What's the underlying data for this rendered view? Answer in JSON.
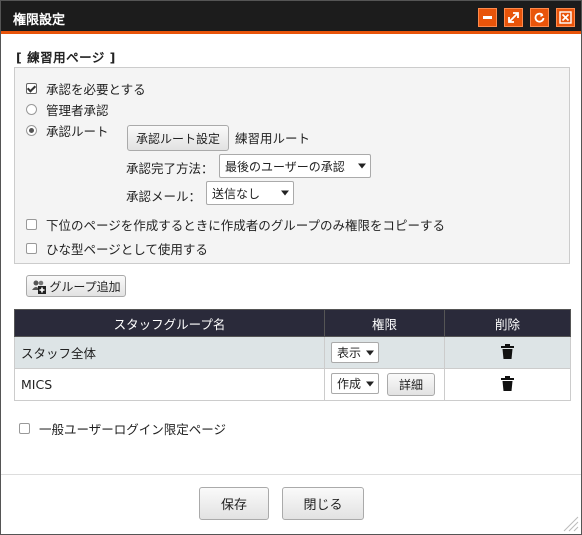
{
  "window": {
    "title": "権限設定"
  },
  "page": {
    "name": "[ 練習用ページ ]"
  },
  "approval": {
    "require_label": "承認を必要とする",
    "admin_label": "管理者承認",
    "route_label": "承認ルート",
    "route_button": "承認ルート設定",
    "route_name": "練習用ルート",
    "complete_method_label": "承認完了方法：",
    "complete_method_value": "最後のユーザーの承認",
    "mail_label": "承認メール：",
    "mail_value": "送信なし"
  },
  "options": {
    "copy_group_label": "下位のページを作成するときに作成者のグループのみ権限をコピーする",
    "template_label": " ひな型ページとして使用する"
  },
  "add_group_button": "グループ追加",
  "table": {
    "headers": [
      "スタッフグループ名",
      "権限",
      "削除"
    ],
    "rows": [
      {
        "group": "スタッフ全体",
        "permission": "表示"
      },
      {
        "group": "MICS",
        "permission": "作成",
        "detail": "詳細"
      }
    ]
  },
  "login_limited_label": "一般ユーザーログイン限定ページ",
  "footer": {
    "save": "保存",
    "close": "閉じる"
  },
  "colors": {
    "accent": "#e8540a",
    "titlebar": "#1c1c1c",
    "table_header": "#2a2a3a",
    "row_shade": "#dde4e6"
  }
}
